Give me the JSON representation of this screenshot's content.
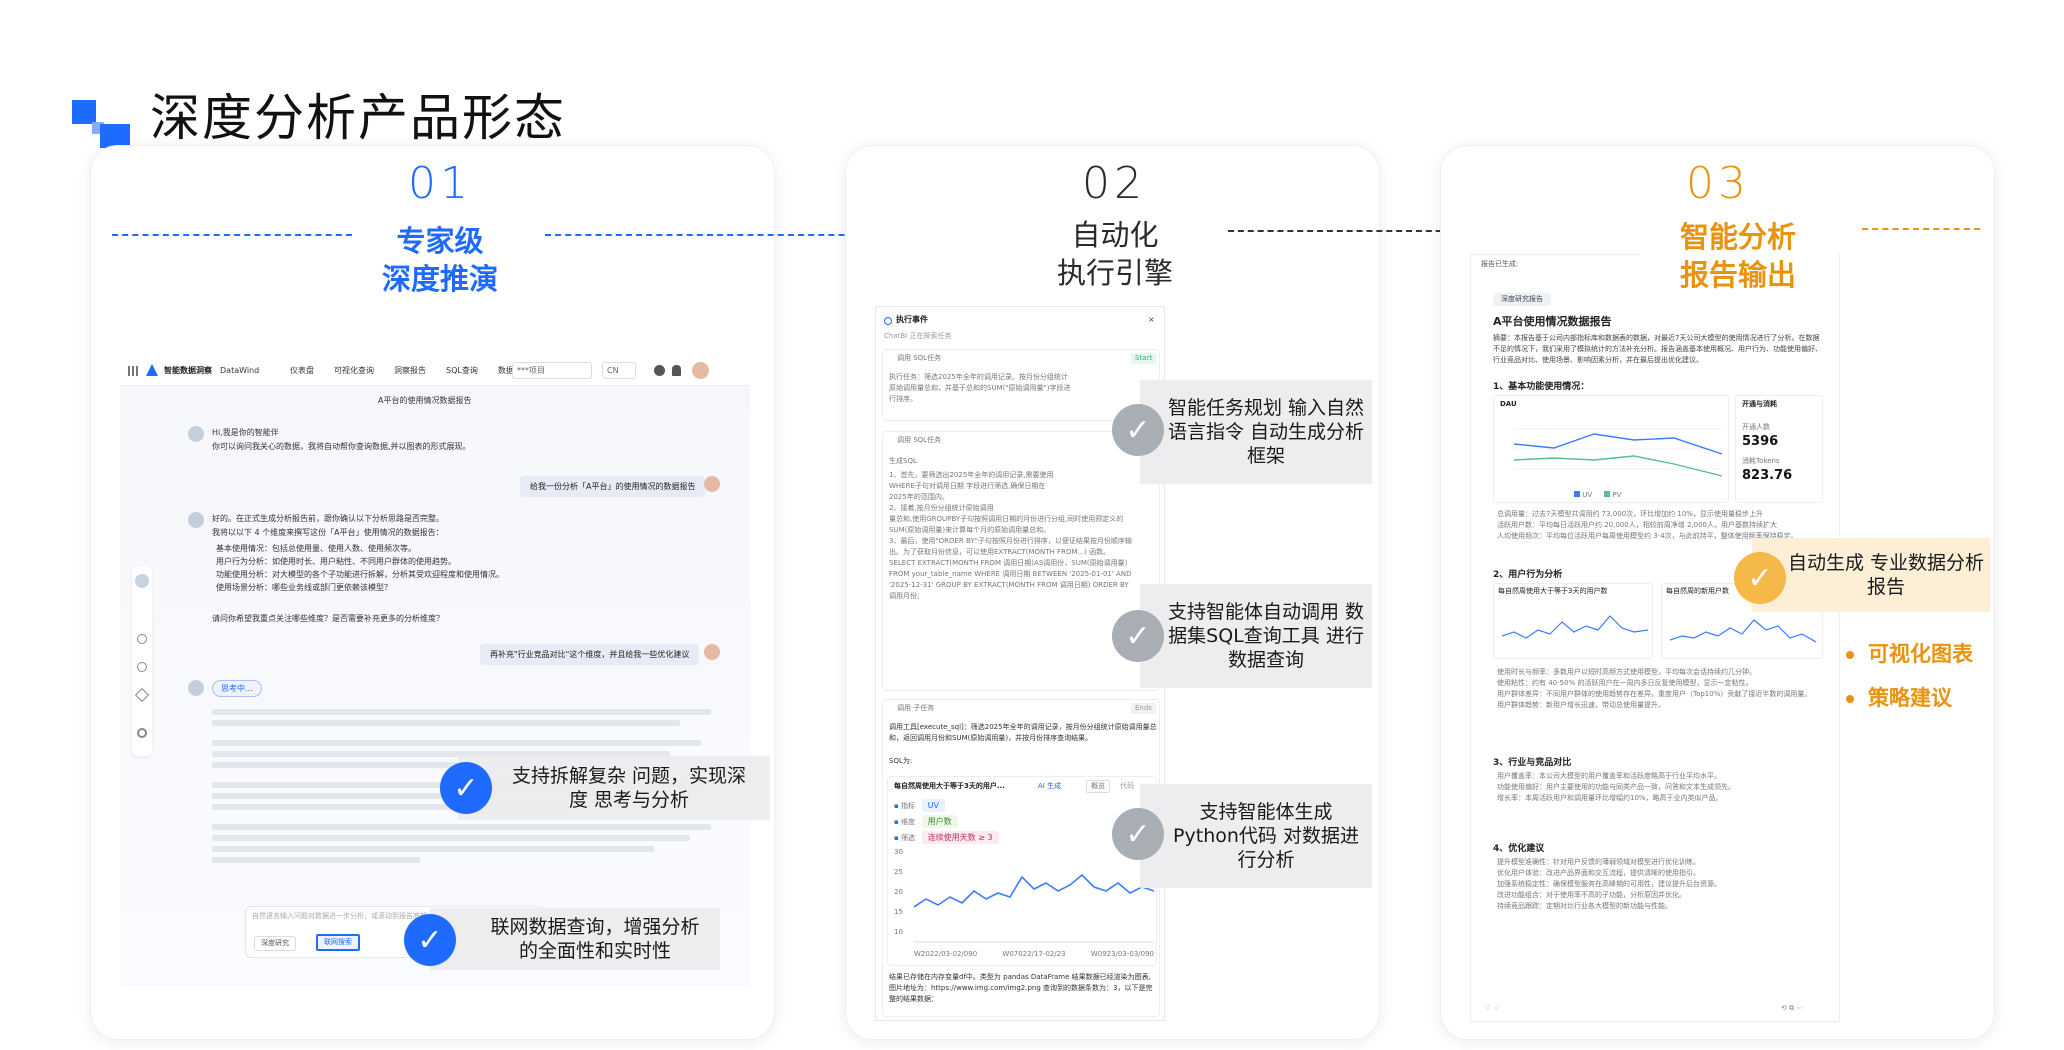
{
  "page": {
    "title": "深度分析产品形态",
    "accent_blue": "#1f6bff",
    "accent_orange": "#e89411",
    "icons": {
      "logo": "square-logo-icon",
      "check": "check-icon"
    }
  },
  "steps": [
    {
      "num": "01",
      "label_line1": "专家级",
      "label_line2": "深度推演",
      "color": "#1f6bff"
    },
    {
      "num": "02",
      "label_line1": "自动化",
      "label_line2": "执行引擎",
      "color": "#2a2a2a"
    },
    {
      "num": "03",
      "label_line1": "智能分析",
      "label_line2": "报告输出",
      "color": "#e89411"
    }
  ],
  "card1": {
    "app_name": "智能数据洞察",
    "app_sub": "DataWind",
    "nav": [
      "仪表盘",
      "可视化查询",
      "洞察报告",
      "SQL查询",
      "数据集"
    ],
    "project_select": "***项目",
    "lang_select": "CN",
    "report_title": "A平台的使用情况数据报告",
    "greeting1": "Hi,我是你的智能伴",
    "greeting2": "你可以询问我关心的数据，我将自动帮你查询数据,并以图表的形式展现。",
    "user_msg1": "给我一份分析「A平台」的使用情况的数据报告",
    "reply1": "好的。在正式生成分析报告前，跟你确认以下分析思路是否完整。",
    "reply2": "我将以以下 4 个维度来撰写这份「A平台」使用情况的数据报告：",
    "dims": [
      "基本使用情况：包括总使用量、使用人数、使用频次等。",
      "用户行为分析：如使用时长、用户粘性、不同用户群体的使用趋势。",
      "功能使用分析：对大模型的各个子功能进行拆解，分析其受欢迎程度和使用情况。",
      "使用场景分析：哪些业务线或部门更依赖该模型？"
    ],
    "reply3": "请问你希望我重点关注哪些维度？是否需要补充更多的分析维度？",
    "user_msg2": "再补充\"行业竞品对比\"这个维度，并且给我一些优化建议",
    "thinking": "思考中...",
    "input_placeholder": "自然语言输入问题对数据进一步分析，或滚动到报告底部",
    "btn_deep": "深度研究",
    "btn_web": "联网搜索",
    "callout_a": "支持拆解复杂 问题，实现深度 思考与分析",
    "callout_b": "联网数据查询，增强分析 的全面性和实时性"
  },
  "card2": {
    "panel_title": "执行事件",
    "panel_sub": "ChatBI 正在探索任务",
    "task1": "调用 SQL任务",
    "task1_badge": "Start",
    "task1_text": "执行任务：筛选2025年全年的调用记录。按月份分组统计原始调用量总和，并基于总和的SUM(\"原始调用量\")字段进行排序。",
    "task2": "调用 SQL任务",
    "sql_head": "生成SQL",
    "sql_lines": [
      "1、首先，要筛选出2025年全年的调用记录,需要使用",
      "WHERE子句对调用日期 字段进行筛选,确保日期在",
      "2025年的范围内。",
      "2、接着,按月份分组统计原始调用",
      "量总和,使用GROUPBY子句按照调用日期的月份进行分组,同时使用预定义的",
      "SUM(原始调用量)来计算每个月的原始调用量总和。",
      "3、最后，使用\"ORDER BY\"子句按照月份进行排序，以便证结果按月份顺序输",
      "出。为了获取月份信息，可以使用EXTRACT(MONTH FROM...) 函数。",
      "SELECT EXTRACT(MONTH FROM 调用日期)AS调用份，SUM(原始调用量)",
      "FROM your_table_name WHERE 调用日期 BETWEEN '2025-01-01' AND",
      "'2025-12-31' GROUP BY EXTRACT(MONTH FROM 调用日期) ORDER BY",
      "调用月份;"
    ],
    "task3": "调用 子任务",
    "task3_badge": "Ends",
    "task3_text": "调用工具[execute_sql]：筛选2025年全年的调用记录，按月份分组统计原始调用量总和，返回调用月份和SUM(原始调用量)，并按月份排序查询结果。",
    "sql_label": "SQL为:",
    "chart_title": "每自然周使用大于等于3天的用户...",
    "chart_tag": "AI 生成",
    "chart_btn1": "概览",
    "chart_btn2": "代码",
    "filters": [
      {
        "k": "指标",
        "v": "UV"
      },
      {
        "k": "维度",
        "v": "用户数"
      },
      {
        "k": "筛选",
        "v": "连续使用天数 ≥ 3"
      }
    ],
    "yticks": [
      "30",
      "25",
      "20",
      "15",
      "10"
    ],
    "xticks": [
      "W2022/03-02/090",
      "W07022/17-02/23",
      "W0923/03-03/090"
    ],
    "result_text": "结果已存储在内存变量df中。类型为 pandas DataFrame 结果数据已经渲染为图表,图片地址为：https://www.img.com/img2.png 查询到的数据条数为：3，以下是完整的结果数据：",
    "callout_1": "智能任务规划 输入自然语言指令 自动生成分析框架",
    "callout_2": "支持智能体自动调用 数据集SQL查询工具 进行数据查询",
    "callout_3": "支持智能体生成 Python代码 对数据进行分析"
  },
  "card3": {
    "head": "报告已生成:",
    "tag": "深度研究报告",
    "report_title": "A平台使用情况数据报告",
    "summary": "摘要：本报告基于公司内部指标库和数据表的数据，对最近7天公司大模型的使用情况进行了分析。在数据不足的情况下，我们采用了模拟统计的方法补充分析。报告涵盖基本使用概况、用户行为、功能使用偏好、行业竞品对比、使用场景、影响因素分析，并在最后提出优化建议。",
    "sec1": "1、基本功能使用情况：",
    "dau_label": "DAU",
    "side_title": "开通与消耗",
    "side_k1": "开通人数",
    "side_v1": "5396",
    "side_k2": "消耗Tokens",
    "side_v2": "823.76",
    "legend": [
      "UV",
      "PV"
    ],
    "bullets1": [
      "总调用量：过去7天模型共调用约 73,000次，环比增加约 10%，显示使用量稳步上升",
      "活跃用户数：平均每日活跃用户约 20,000人，相较前周净增 2,000人，用户基数持续扩大",
      "人均使用频次：平均每位活跃用户每周使用模型约 3-4次，与此前持平，整体使用频率保持稳定。"
    ],
    "sec2": "2、用户行为分析",
    "mini1": "每自然周使用大于等于3天的用户数",
    "mini2": "每自然周的新用户数",
    "bullets2": [
      "使用时长与频率：多数用户以短时高频方式使用模型，平均每次会话持续约几分钟。",
      "使用粘性：约有 40-50% 的活跃用户在一周内多日反复使用模型，显示一定粘性。",
      "用户群体差异：不同用户群体的使用趋势存在差异。重度用户（Top10%）贡献了接近半数的调用量。",
      "用户群体趋势：新用户增长迅速，带动总使用量提升。"
    ],
    "sec3": "3、行业与竞品对比",
    "bullets3": [
      "用户覆盖率：本公司大模型的用户覆盖率和活跃度略高于行业平均水平。",
      "功能使用偏好：用户主要使用的功能与同类产品一致，问答和文本生成领先。",
      "增长率：本周活跃用户和调用量环比增幅约10%，略高于业内类似产品。"
    ],
    "sec4": "4、优化建议",
    "bullets4": [
      "提升模型准确性：针对用户反馈的薄弱领域对模型进行优化训练。",
      "优化用户体验：改进产品界面和交互流程，提供清晰的使用指引。",
      "加强系统稳定性：确保模型服务在高峰期的可用性，建议提升后台资源。",
      "改进功能组合：对于使用率不高的子功能，分析原因并优化。",
      "持续竞品跟踪：定期对比行业各大模型的新功能与性能。"
    ],
    "callout_report": "自动生成 专业数据分析报告",
    "extra1": "可视化图表",
    "extra2": "策略建议"
  }
}
